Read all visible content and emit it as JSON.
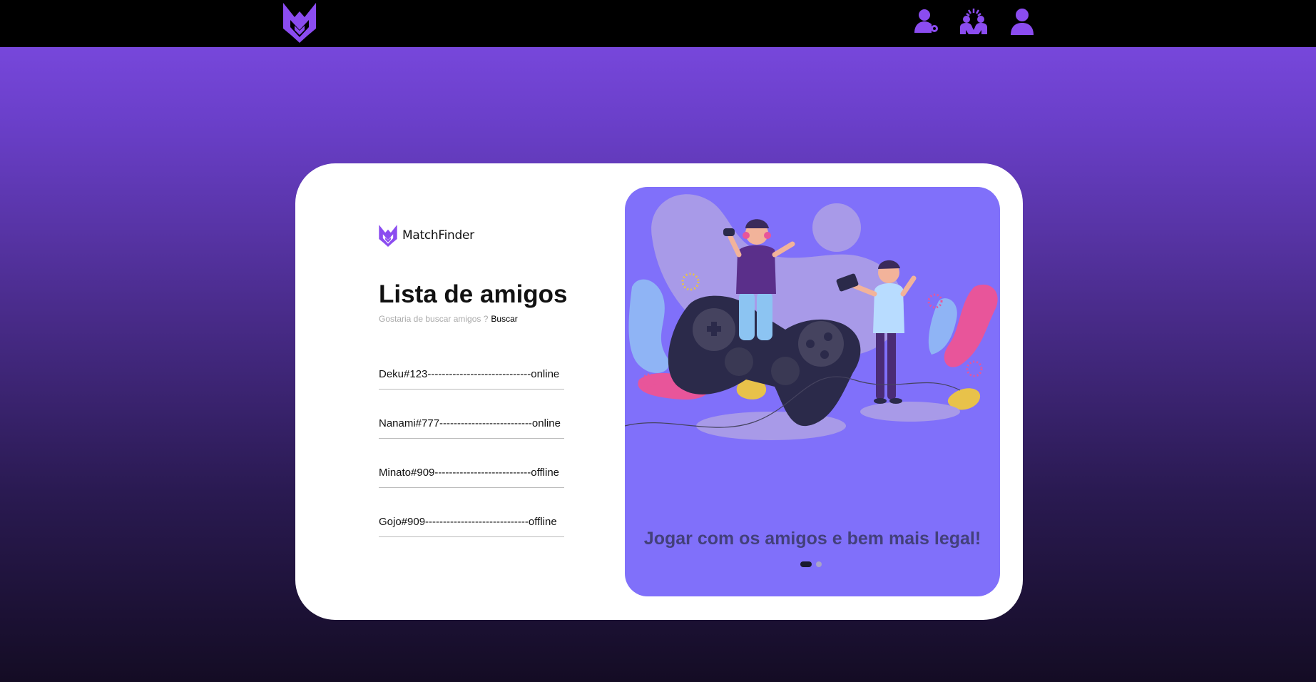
{
  "header": {
    "logo_icon": "matchfinder-logo-icon",
    "nav": [
      {
        "icon": "user-key-icon"
      },
      {
        "icon": "group-icon"
      },
      {
        "icon": "user-profile-icon"
      }
    ],
    "accent_color": "#8b4cf0"
  },
  "card": {
    "brand": {
      "name": "MatchFinder",
      "icon": "matchfinder-logo-icon"
    },
    "title": "Lista de amigos",
    "subtitle": "Gostaria de buscar amigos ?",
    "search_link": "Buscar",
    "friends": [
      {
        "text": "Deku#123-----------------------------online"
      },
      {
        "text": "Nanami#777--------------------------online"
      },
      {
        "text": "Minato#909---------------------------offline"
      },
      {
        "text": "Gojo#909-----------------------------offline"
      }
    ]
  },
  "carousel": {
    "caption": "Jogar com os amigos e bem mais legal!",
    "active_slide": 1,
    "slide_count": 2,
    "panel_color": "#8070fa",
    "illustration": "gamers-with-controller-illustration"
  }
}
